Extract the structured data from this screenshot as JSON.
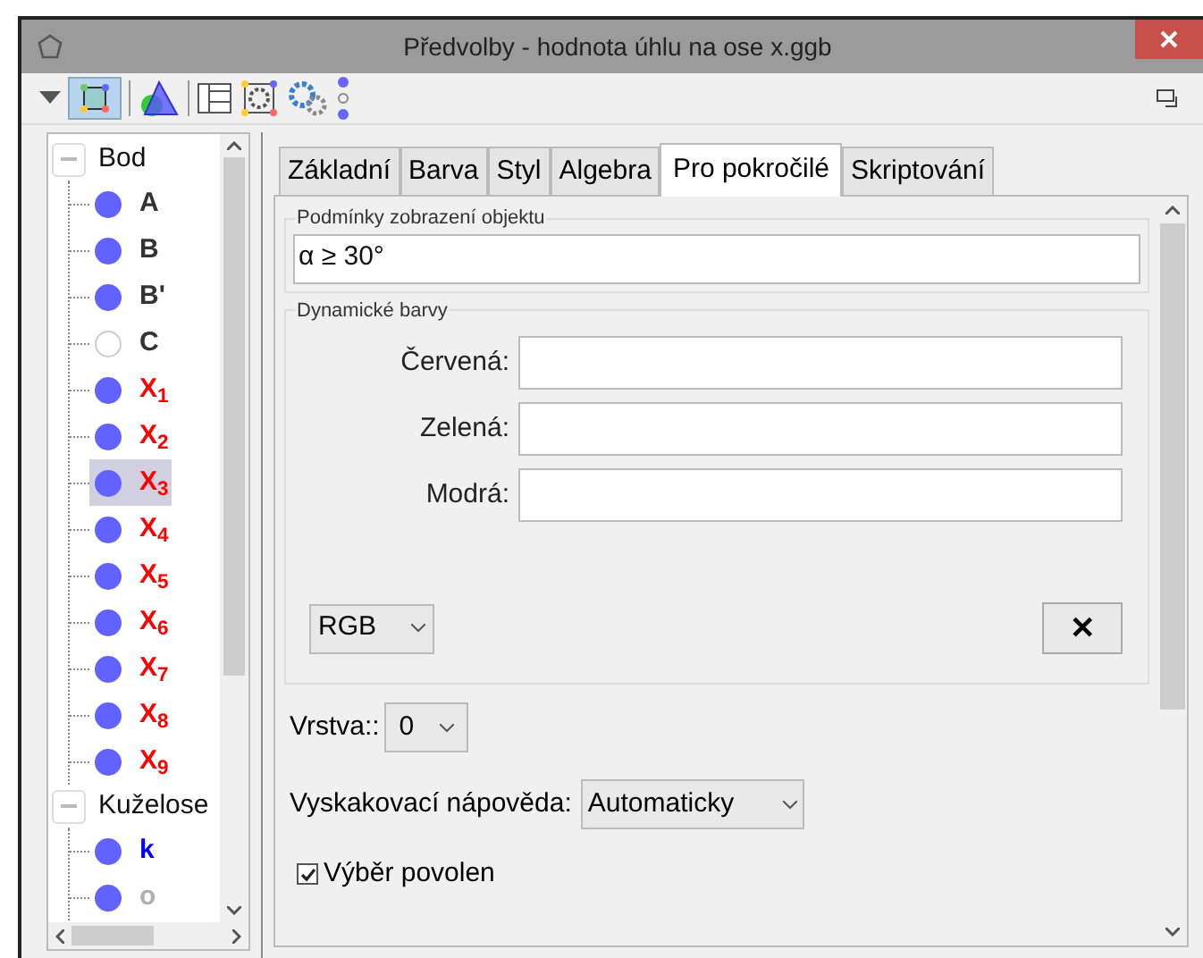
{
  "window": {
    "title": "Předvolby - hodnota úhlu na ose x.ggb"
  },
  "tree": [
    {
      "label": "Bod",
      "expanded": true,
      "children": [
        {
          "label": "A",
          "visible": true,
          "color": "#333333",
          "selected": false
        },
        {
          "label": "B",
          "visible": true,
          "color": "#333333",
          "selected": false
        },
        {
          "label": "B'",
          "visible": true,
          "color": "#333333",
          "selected": false
        },
        {
          "label": "C",
          "visible": false,
          "color": "#333333",
          "selected": false
        },
        {
          "label": "X$_{1}$",
          "visible": true,
          "color": "#ff0000",
          "selected": false
        },
        {
          "label": "X$_{2}$",
          "visible": true,
          "color": "#ff0000",
          "selected": false
        },
        {
          "label": "X$_{3}$",
          "visible": true,
          "color": "#ff0000",
          "selected": true
        },
        {
          "label": "X$_{4}$",
          "visible": true,
          "color": "#ff0000",
          "selected": false
        },
        {
          "label": "X$_{5}$",
          "visible": true,
          "color": "#ff0000",
          "selected": false
        },
        {
          "label": "X$_{6}$",
          "visible": true,
          "color": "#ff0000",
          "selected": false
        },
        {
          "label": "X$_{7}$",
          "visible": true,
          "color": "#ff0000",
          "selected": false
        },
        {
          "label": "X$_{8}$",
          "visible": true,
          "color": "#ff0000",
          "selected": false
        },
        {
          "label": "X$_{9}$",
          "visible": true,
          "color": "#ff0000",
          "selected": false
        }
      ]
    },
    {
      "label": "Kuželose",
      "expanded": true,
      "children": [
        {
          "label": "k",
          "visible": true,
          "color": "#0000ff",
          "selected": false
        },
        {
          "label": "o",
          "visible": true,
          "color": "#b0b0b0",
          "selected": false
        }
      ]
    }
  ],
  "tabs": [
    {
      "label": "Základní",
      "selected": false
    },
    {
      "label": "Barva",
      "selected": false
    },
    {
      "label": "Styl",
      "selected": false
    },
    {
      "label": "Algebra",
      "selected": false
    },
    {
      "label": "Pro pokročilé",
      "selected": true
    },
    {
      "label": "Skriptování",
      "selected": false
    }
  ],
  "condition": {
    "title": "Podmínky zobrazení objektu",
    "value": "α ≥ 30°"
  },
  "dynamic_colors": {
    "title": "Dynamické barvy",
    "fields": [
      {
        "label": "Červená:"
      },
      {
        "label": "Zelená:"
      },
      {
        "label": "Modrá:"
      }
    ],
    "mode": "RGB",
    "clear_button": "✕"
  },
  "layer": {
    "label": "Vrstva::",
    "value": "0"
  },
  "tooltip": {
    "label": "Vyskakovací nápověda:",
    "value": "Automaticky"
  },
  "selection_allowed": {
    "label": "Výběr povolen",
    "checked": true
  }
}
